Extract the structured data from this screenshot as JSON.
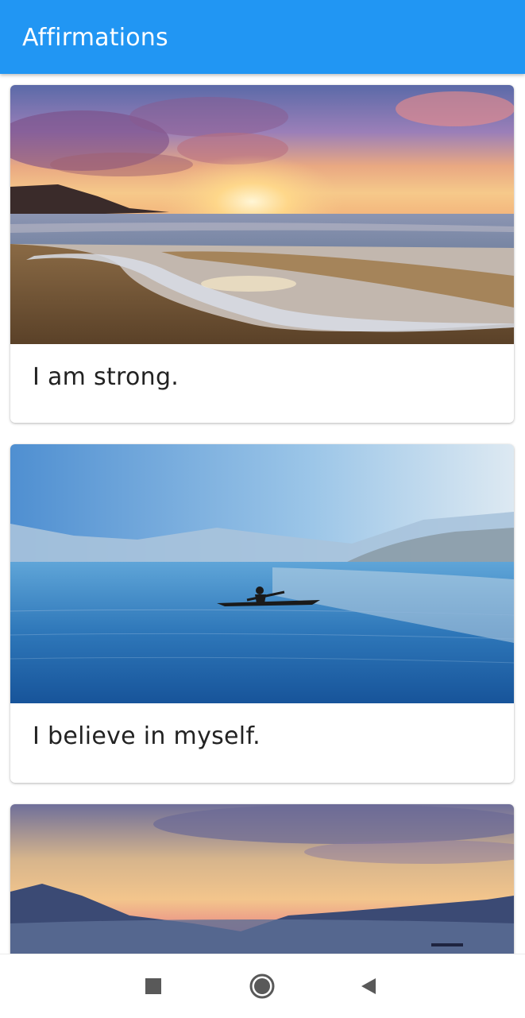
{
  "app_bar": {
    "title": "Affirmations",
    "color": "#2196F3"
  },
  "cards": [
    {
      "text": "I am strong.",
      "image": "sunset-beach-image"
    },
    {
      "text": "I believe in myself.",
      "image": "lake-kayaker-image"
    },
    {
      "text": "",
      "image": "mountain-dusk-image"
    }
  ],
  "nav_bar": {
    "buttons": [
      "recents-square-icon",
      "home-circle-icon",
      "back-triangle-icon"
    ]
  }
}
